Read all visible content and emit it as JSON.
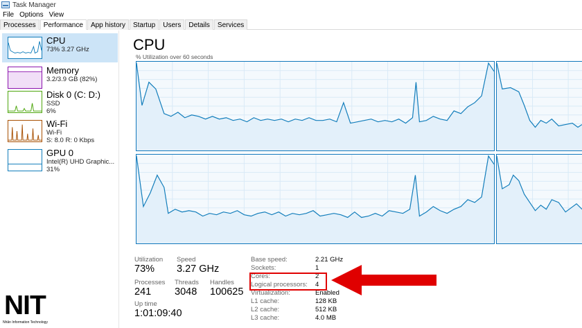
{
  "window": {
    "title": "Task Manager",
    "icon": "task-manager-icon"
  },
  "menu": [
    "File",
    "Options",
    "View"
  ],
  "tabs": [
    {
      "label": "Processes",
      "active": false
    },
    {
      "label": "Performance",
      "active": true
    },
    {
      "label": "App history",
      "active": false
    },
    {
      "label": "Startup",
      "active": false
    },
    {
      "label": "Users",
      "active": false
    },
    {
      "label": "Details",
      "active": false
    },
    {
      "label": "Services",
      "active": false
    }
  ],
  "sidebar": {
    "items": [
      {
        "name": "CPU",
        "line1": "73%  3.27 GHz",
        "line2": "",
        "color": "#117dbb"
      },
      {
        "name": "Memory",
        "line1": "3.2/3.9 GB (82%)",
        "line2": "",
        "color": "#8b12ae"
      },
      {
        "name": "Disk 0 (C: D:)",
        "line1": "SSD",
        "line2": "6%",
        "color": "#4da60c"
      },
      {
        "name": "Wi-Fi",
        "line1": "Wi-Fi",
        "line2": "S: 8.0  R: 0 Kbps",
        "color": "#a74f01"
      },
      {
        "name": "GPU 0",
        "line1": "Intel(R) UHD Graphic...",
        "line2": "31%",
        "color": "#117dbb"
      }
    ]
  },
  "main": {
    "title": "CPU",
    "graph_label": "% Utilization over 60 seconds",
    "stats": {
      "utilization": {
        "label": "Utilization",
        "value": "73%"
      },
      "speed": {
        "label": "Speed",
        "value": "3.27 GHz"
      },
      "processes": {
        "label": "Processes",
        "value": "241"
      },
      "threads": {
        "label": "Threads",
        "value": "3048"
      },
      "handles": {
        "label": "Handles",
        "value": "100625"
      },
      "uptime": {
        "label": "Up time",
        "value": "1:01:09:40"
      }
    },
    "specs": [
      {
        "key": "Base speed:",
        "value": "2.21 GHz"
      },
      {
        "key": "Sockets:",
        "value": "1"
      },
      {
        "key": "Cores:",
        "value": "2"
      },
      {
        "key": "Logical processors:",
        "value": "4"
      },
      {
        "key": "Virtualization:",
        "value": "Enabled"
      },
      {
        "key": "L1 cache:",
        "value": "128 KB"
      },
      {
        "key": "L2 cache:",
        "value": "512 KB"
      },
      {
        "key": "L3 cache:",
        "value": "4.0 MB"
      }
    ]
  },
  "annotation": {
    "highlight_color": "#e00000"
  },
  "logo": {
    "text": "NIT",
    "subtitle": "Nhân Information Technology"
  }
}
